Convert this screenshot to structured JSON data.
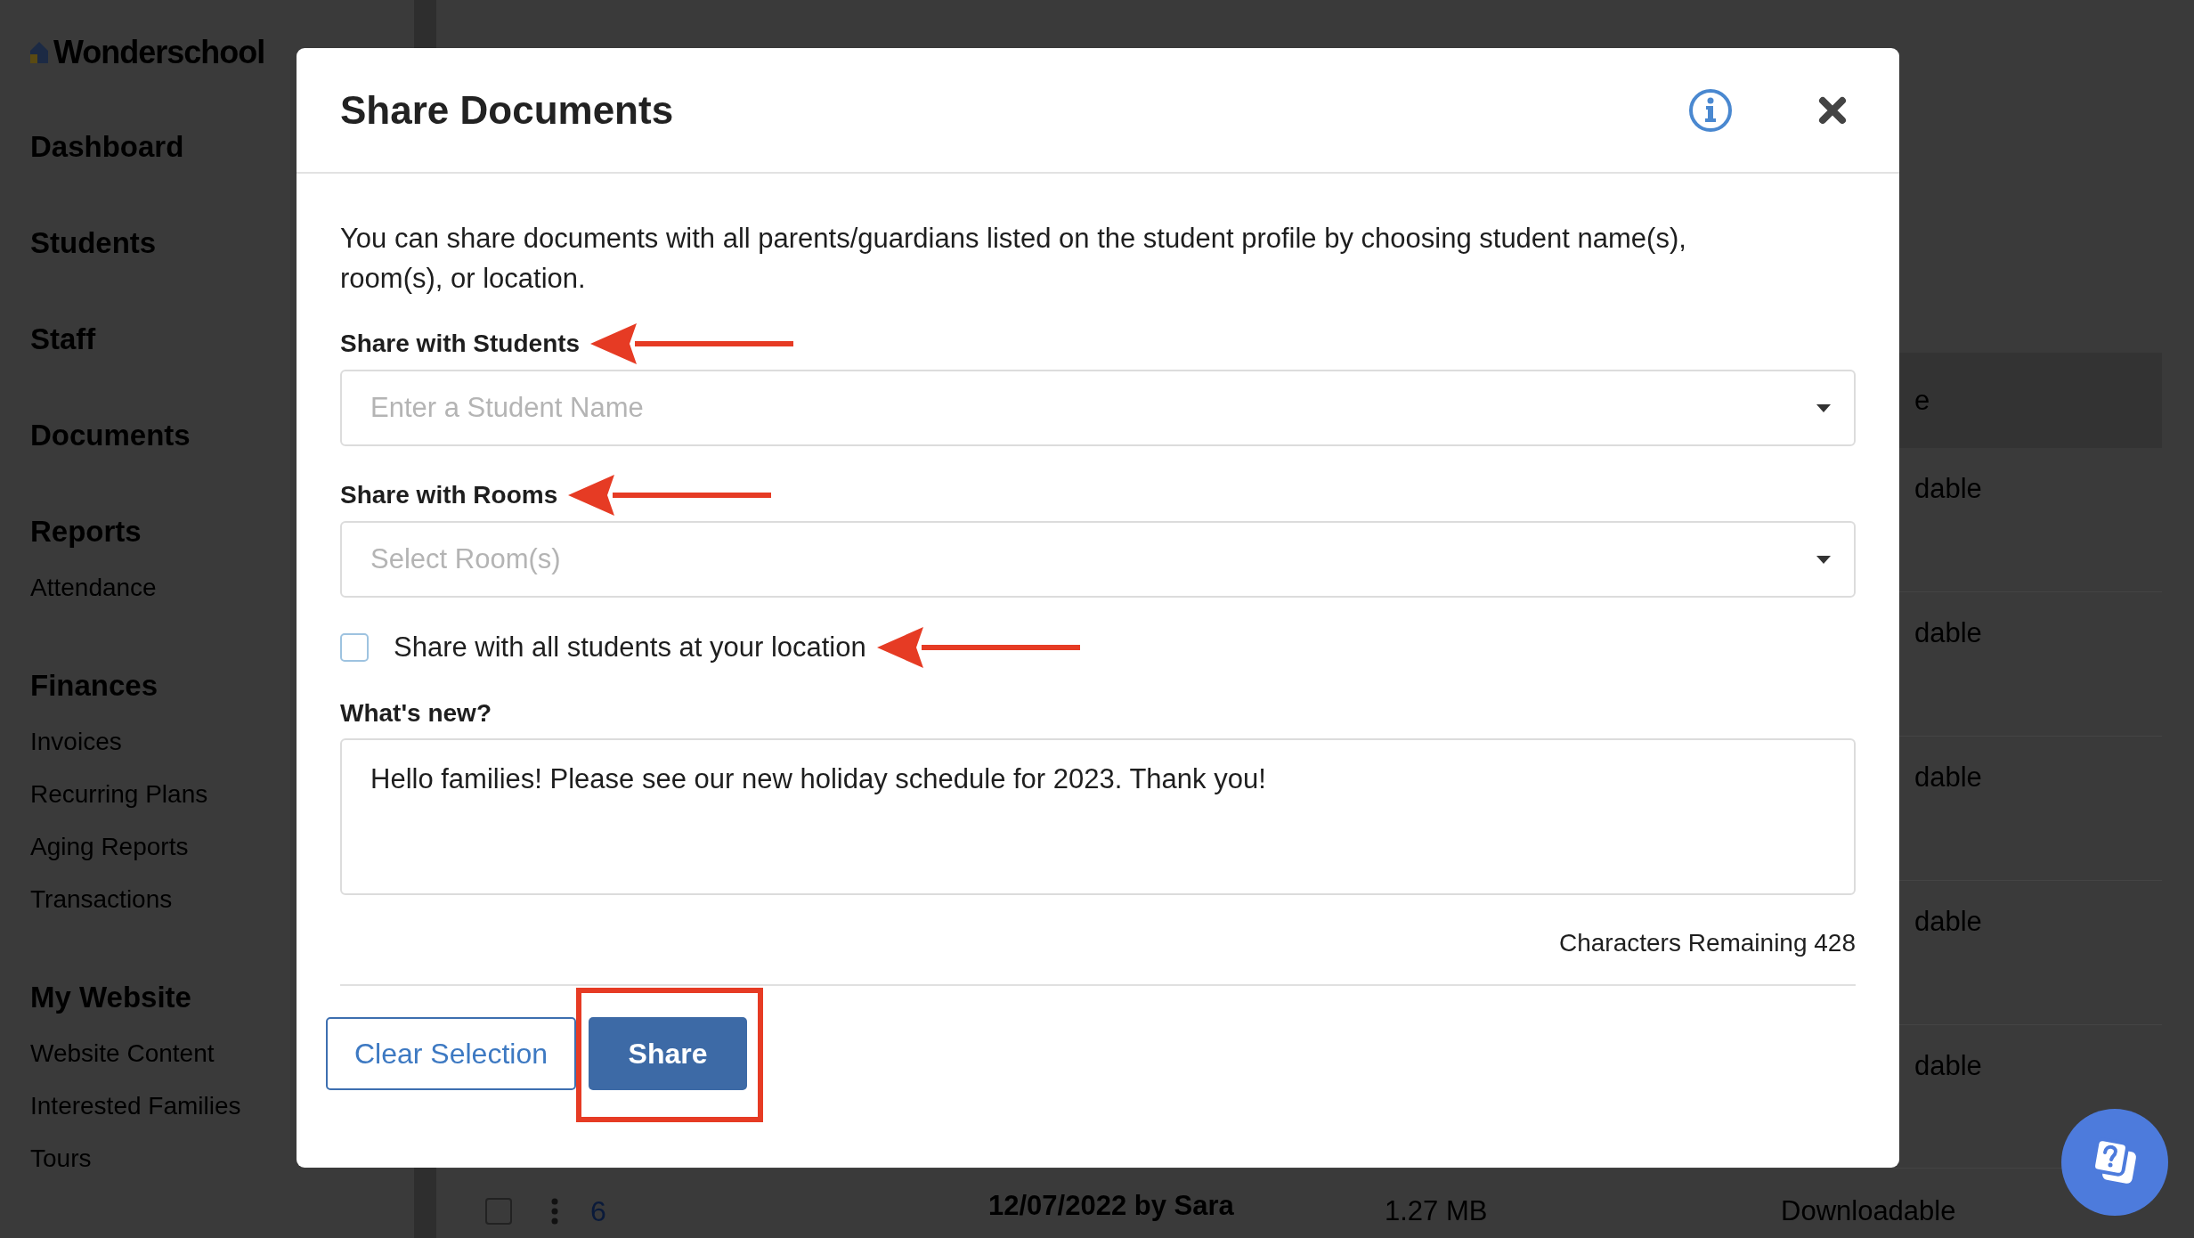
{
  "sidebar": {
    "logo": "Wonderschool",
    "sections": [
      {
        "title": "Dashboard"
      },
      {
        "title": "Students"
      },
      {
        "title": "Staff"
      },
      {
        "title": "Documents"
      },
      {
        "title": "Reports",
        "items": [
          "Attendance"
        ]
      },
      {
        "title": "Finances",
        "items": [
          "Invoices",
          "Recurring Plans",
          "Aging Reports",
          "Transactions"
        ]
      },
      {
        "title": "My Website",
        "items": [
          "Website Content",
          "Interested Families",
          "Tours"
        ]
      }
    ]
  },
  "background_table": {
    "header_fragment": "e",
    "row_fragments": [
      "dable",
      "dable",
      "dable",
      "dable",
      "dable"
    ],
    "last_row": {
      "checked": false,
      "number": "6",
      "date": "12/07/2022 by Sara",
      "size": "1.27 MB",
      "status": "Downloadable"
    }
  },
  "dialog": {
    "title": "Share Documents",
    "description": "You can share documents with all parents/guardians listed on the student profile by choosing student name(s), room(s), or location.",
    "fields": [
      {
        "label": "Share with Students",
        "placeholder": "Enter a Student Name",
        "annotated": true
      },
      {
        "label": "Share with Rooms",
        "placeholder": "Select Room(s)",
        "annotated": true
      }
    ],
    "location_checkbox": {
      "label": "Share with all students at your location",
      "checked": false,
      "annotated": true
    },
    "message": {
      "label": "What's new?",
      "value": "Hello families! Please see our new holiday schedule for 2023. Thank you!",
      "counter": "Characters Remaining 428"
    },
    "buttons": [
      {
        "label": "Clear Selection",
        "kind": "outline",
        "highlighted": false
      },
      {
        "label": "Share",
        "kind": "primary",
        "highlighted": true
      }
    ]
  }
}
